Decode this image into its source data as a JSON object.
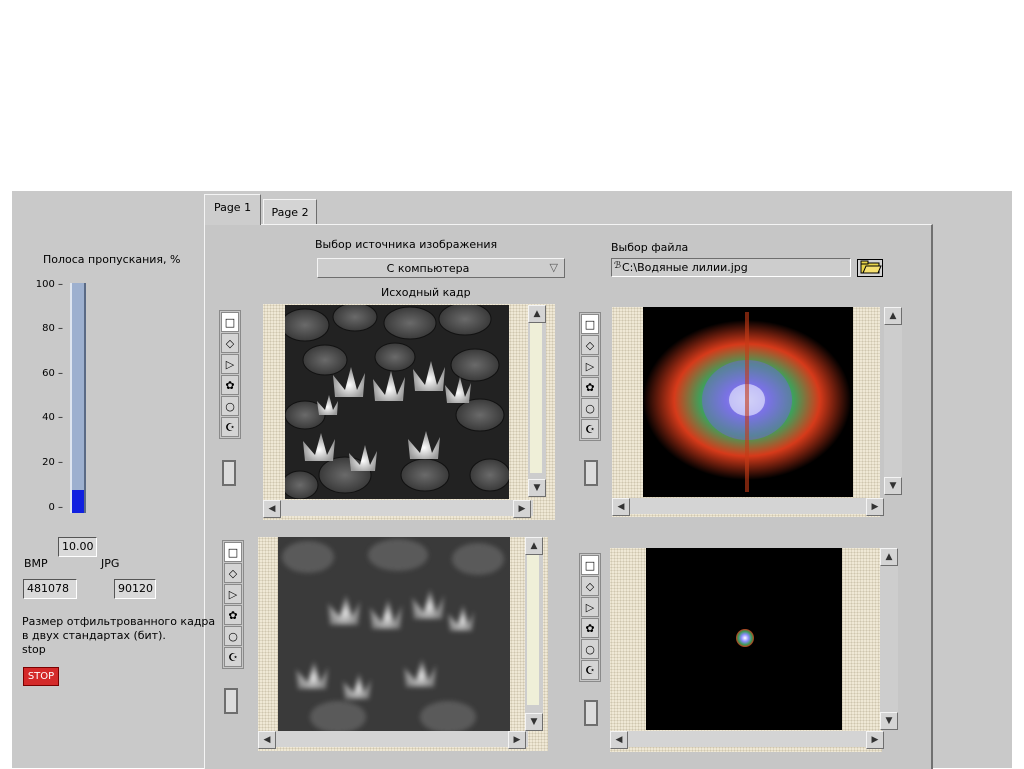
{
  "tabs": [
    {
      "label": "Page 1"
    },
    {
      "label": "Page 2"
    }
  ],
  "bandwidth": {
    "label": "Полоса пропускания, %",
    "scale": [
      "100",
      "80",
      "60",
      "40",
      "20",
      "0"
    ],
    "value_text": "10.00",
    "level": 0.1
  },
  "sizes": {
    "bmp_label": "BMP",
    "jpg_label": "JPG",
    "bmp_value": "481078",
    "jpg_value": "90120",
    "caption_line1": "Размер отфильтрованного кадра",
    "caption_line2": "в двух стандартах (бит).",
    "stop_label": "stop",
    "stop_button": "STOP"
  },
  "source": {
    "label": "Выбор источника изображения",
    "selected": "С компьютера",
    "original_frame_label": "Исходный кадр"
  },
  "file": {
    "label": "Выбор файла",
    "path": "C:\\Водяные лилии.jpg"
  },
  "icons": {
    "tools": [
      "rect-tool-icon",
      "rotated-rect-tool-icon",
      "polygon-tool-icon",
      "freehand-tool-icon",
      "oval-tool-icon",
      "annulus-tool-icon"
    ],
    "folder": "folder-open-icon",
    "dropdown": "dropdown-arrow-icon"
  },
  "colors": {
    "panel": "#c9c9c9",
    "stop_button": "#d42a2a",
    "bar_fill": "#1020e0",
    "bar_track": "#9db0cf"
  }
}
